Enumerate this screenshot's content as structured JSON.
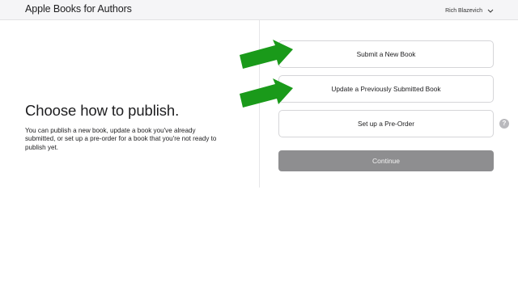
{
  "header": {
    "app_title": "Apple Books for Authors",
    "user_name": "Rich Blazevich",
    "background": "#f5f5f7"
  },
  "main": {
    "heading": "Choose how to publish.",
    "description": "You can publish a new book, update a book you've already submitted, or set up a pre-order for a book that you're not ready to publish yet."
  },
  "options": [
    {
      "label": "Submit a New Book"
    },
    {
      "label": "Update a Previously Submitted Book"
    },
    {
      "label": "Set up a Pre-Order"
    }
  ],
  "help_icon": {
    "glyph": "?",
    "icon": "question-circle-icon"
  },
  "continue_button": {
    "label": "Continue",
    "color": "#8e8e90",
    "state": "disabled"
  },
  "annotations": {
    "arrow_color": "#1a9a1a",
    "arrow_icon": "green-arrow-icon"
  }
}
